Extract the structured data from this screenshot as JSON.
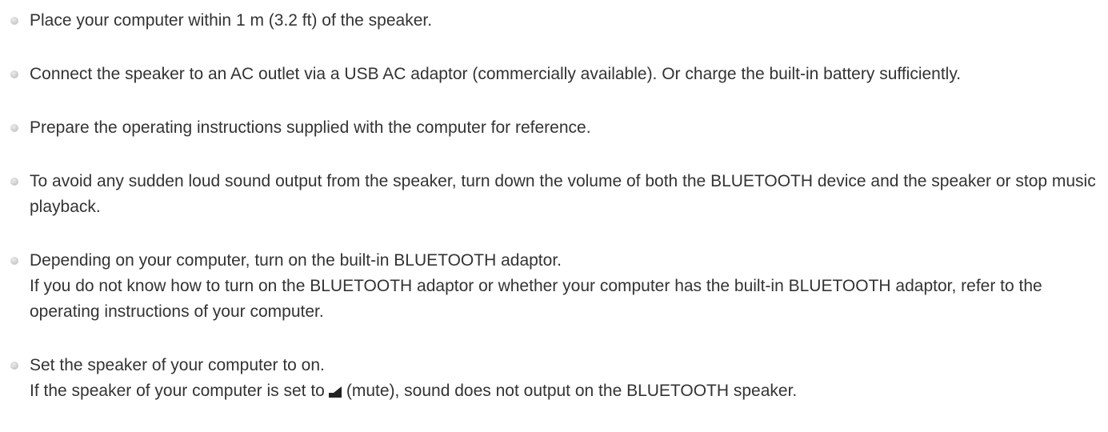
{
  "items": [
    {
      "text": "Place your computer within 1 m (3.2 ft) of the speaker."
    },
    {
      "text": "Connect the speaker to an AC outlet via a USB AC adaptor (commercially available). Or charge the built-in battery sufficiently."
    },
    {
      "text": "Prepare the operating instructions supplied with the computer for reference."
    },
    {
      "text": "To avoid any sudden loud sound output from the speaker, turn down the volume of both the BLUETOOTH device and the speaker or stop music playback."
    },
    {
      "line1": "Depending on your computer, turn on the built-in BLUETOOTH adaptor.",
      "line2": "If you do not know how to turn on the BLUETOOTH adaptor or whether your computer has the built-in BLUETOOTH adaptor, refer to the operating instructions of your computer."
    },
    {
      "line1": "Set the speaker of your computer to on.",
      "line2_before": "If the speaker of your computer is set to",
      "line2_icon": "speaker-mute-icon",
      "line2_after": "(mute), sound does not output on the BLUETOOTH speaker."
    }
  ]
}
